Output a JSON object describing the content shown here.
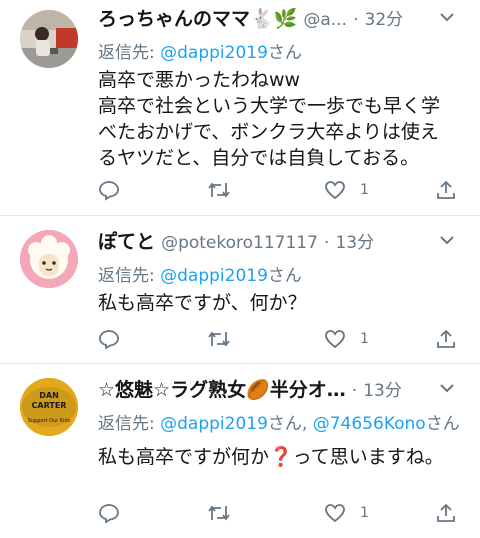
{
  "tweets": [
    {
      "name": "ろっちゃんのママ🐇🌿",
      "handle": "@a...",
      "time": "32分",
      "reply_prefix": "返信先: ",
      "mentions": [
        "@dappi2019"
      ],
      "reply_suffix": "さん",
      "text_lines": [
        "高卒で悪かったわねww",
        "高卒で社会という大学で一歩でも早く学",
        "べたおかげで、ボンクラ大卒よりは使え",
        "るヤツだと、自分では自負しておる。"
      ],
      "like_count": "1",
      "avatar": "photo-avatar"
    },
    {
      "name": "ぽてと",
      "handle": "@potekoro117117",
      "time": "13分",
      "reply_prefix": "返信先: ",
      "mentions": [
        "@dappi2019"
      ],
      "reply_suffix": "さん",
      "text_lines": [
        "私も高卒ですが、何か？"
      ],
      "like_count": "1",
      "avatar": "alpaca-avatar"
    },
    {
      "name": "☆悠魅☆ラグ熟女🏉半分オ…",
      "handle": "",
      "time": "13分",
      "reply_prefix": "返信先: ",
      "mentions": [
        "@dappi2019",
        "@74656Kono"
      ],
      "reply_suffix": "さん",
      "text_lines": [
        "私も高卒ですが何か❓って思いますね。"
      ],
      "like_count": "1",
      "avatar": "rugby-badge-avatar",
      "badge_text": [
        "DAN",
        "CARTER",
        "Support Our Kids"
      ]
    }
  ],
  "separator": "·",
  "colors": {
    "link": "#1da1f2",
    "muted": "#657786",
    "text": "#14171a",
    "divider": "#e1e8ed"
  }
}
